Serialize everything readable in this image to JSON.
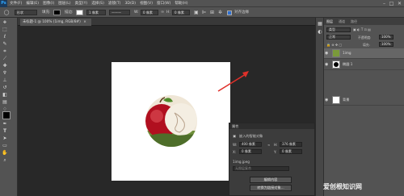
{
  "app": {
    "logo": "Ps"
  },
  "menubar": {
    "items": [
      "文件(F)",
      "编辑(E)",
      "图像(I)",
      "图层(L)",
      "类型(Y)",
      "选择(S)",
      "滤镜(T)",
      "3D(D)",
      "视图(V)",
      "窗口(W)",
      "帮助(H)"
    ],
    "minimize": "–",
    "maximize": "□",
    "close": "✕"
  },
  "options": {
    "shape_mode": "形状",
    "fill_label": "填充:",
    "stroke_label": "描边:",
    "stroke_width": "1 像素",
    "w_label": "W:",
    "w_value": "0 像素",
    "h_label": "H:",
    "h_value": "0 像素",
    "align_edges": "对齐边缘"
  },
  "tab": {
    "title": "未标题-1 @ 100% (1img, RGB/8#)"
  },
  "toolbar": {
    "icons": [
      "move-icon",
      "marquee-icon",
      "lasso-icon",
      "quick-select-icon",
      "crop-icon",
      "eyedropper-icon",
      "healing-icon",
      "brush-icon",
      "stamp-icon",
      "history-brush-icon",
      "eraser-icon",
      "gradient-icon",
      "blur-icon",
      "dodge-icon",
      "pen-icon",
      "type-icon",
      "path-select-icon",
      "rectangle-icon",
      "hand-icon",
      "zoom-icon"
    ]
  },
  "properties": {
    "title": "属性",
    "type": "嵌入的智能对象",
    "w_label": "W:",
    "w_value": "400 像素",
    "h_label": "H:",
    "h_value": "376 像素",
    "x_label": "X:",
    "x_value": "0 像素",
    "y_label": "Y:",
    "y_value": "0 像素",
    "filename": "1img.jpeg",
    "comp_placeholder": "无图层复合",
    "edit_button": "编辑内容",
    "convert_button": "转换为链接对象..."
  },
  "layers": {
    "tabs": [
      "图层",
      "通道",
      "路径"
    ],
    "kind_filter": "类型",
    "blend_mode": "正常",
    "opacity_label": "不透明度:",
    "opacity_value": "100%",
    "fill_label": "填充:",
    "fill_value": "100%",
    "items": [
      {
        "name": "1img"
      },
      {
        "name": "椭圆 1"
      },
      {
        "name": "背景"
      }
    ]
  },
  "watermark": {
    "text": "爱创根知识网"
  },
  "colors": {
    "accent_arrow": "#e0302a",
    "apple_red": "#c8102e",
    "canvas": "#ffffff"
  }
}
